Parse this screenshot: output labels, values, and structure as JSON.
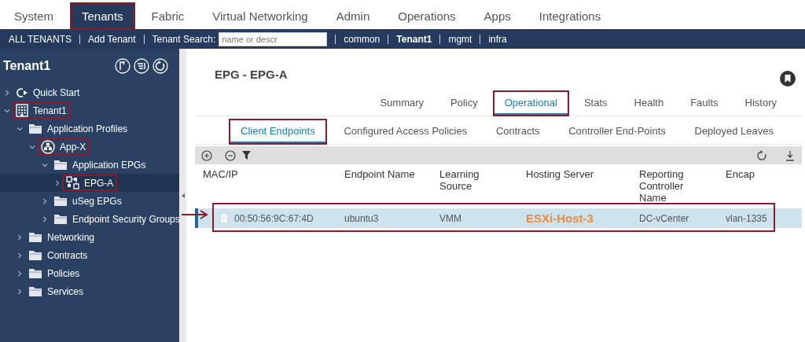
{
  "top_tabs": [
    {
      "label": "System",
      "selected": false,
      "highlighted": false
    },
    {
      "label": "Tenants",
      "selected": true,
      "highlighted": true
    },
    {
      "label": "Fabric",
      "selected": false,
      "highlighted": false
    },
    {
      "label": "Virtual Networking",
      "selected": false,
      "highlighted": false
    },
    {
      "label": "Admin",
      "selected": false,
      "highlighted": false
    },
    {
      "label": "Operations",
      "selected": false,
      "highlighted": false
    },
    {
      "label": "Apps",
      "selected": false,
      "highlighted": false
    },
    {
      "label": "Integrations",
      "selected": false,
      "highlighted": false
    }
  ],
  "tenant_bar": [
    {
      "kind": "link",
      "label": "ALL TENANTS",
      "selected": false
    },
    {
      "kind": "link",
      "label": "Add Tenant",
      "selected": false
    },
    {
      "kind": "search",
      "label": "Tenant Search:",
      "placeholder": "name or descr"
    },
    {
      "kind": "link",
      "label": "common",
      "selected": false
    },
    {
      "kind": "link",
      "label": "Tenant1",
      "selected": true
    },
    {
      "kind": "link",
      "label": "mgmt",
      "selected": false
    },
    {
      "kind": "link",
      "label": "infra",
      "selected": false
    }
  ],
  "sidebar": {
    "title": "Tenant1",
    "tree": [
      {
        "label": "Quick Start",
        "kind": "quickstart",
        "expanded": false,
        "selected": false,
        "highlighted": false
      },
      {
        "label": "Tenant1",
        "kind": "tenant",
        "expanded": true,
        "selected": false,
        "highlighted": true,
        "children": [
          {
            "label": "Application Profiles",
            "kind": "folder",
            "expanded": true,
            "selected": false,
            "highlighted": false,
            "children": [
              {
                "label": "App-X",
                "kind": "app",
                "expanded": true,
                "selected": false,
                "highlighted": true,
                "children": [
                  {
                    "label": "Application EPGs",
                    "kind": "folder",
                    "expanded": true,
                    "selected": false,
                    "highlighted": false,
                    "children": [
                      {
                        "label": "EPG-A",
                        "kind": "epg",
                        "expanded": false,
                        "selected": true,
                        "highlighted": true
                      }
                    ]
                  },
                  {
                    "label": "uSeg EPGs",
                    "kind": "folder",
                    "expanded": false,
                    "selected": false,
                    "highlighted": false
                  },
                  {
                    "label": "Endpoint Security Groups",
                    "kind": "folder",
                    "expanded": false,
                    "selected": false,
                    "highlighted": false
                  }
                ]
              }
            ]
          },
          {
            "label": "Networking",
            "kind": "folder",
            "expanded": false,
            "selected": false,
            "highlighted": false
          },
          {
            "label": "Contracts",
            "kind": "folder",
            "expanded": false,
            "selected": false,
            "highlighted": false
          },
          {
            "label": "Policies",
            "kind": "folder",
            "expanded": false,
            "selected": false,
            "highlighted": false
          },
          {
            "label": "Services",
            "kind": "folder",
            "expanded": false,
            "selected": false,
            "highlighted": false
          }
        ]
      }
    ]
  },
  "main": {
    "title": "EPG - EPG-A",
    "tabs": [
      {
        "label": "Summary",
        "selected": false,
        "highlighted": false
      },
      {
        "label": "Policy",
        "selected": false,
        "highlighted": false
      },
      {
        "label": "Operational",
        "selected": true,
        "highlighted": true
      },
      {
        "label": "Stats",
        "selected": false,
        "highlighted": false
      },
      {
        "label": "Health",
        "selected": false,
        "highlighted": false
      },
      {
        "label": "Faults",
        "selected": false,
        "highlighted": false
      },
      {
        "label": "History",
        "selected": false,
        "highlighted": false
      }
    ],
    "subtabs": [
      {
        "label": "Client Endpoints",
        "selected": true,
        "highlighted": true
      },
      {
        "label": "Configured Access Policies",
        "selected": false,
        "highlighted": false
      },
      {
        "label": "Contracts",
        "selected": false,
        "highlighted": false
      },
      {
        "label": "Controller End-Points",
        "selected": false,
        "highlighted": false
      },
      {
        "label": "Deployed Leaves",
        "selected": false,
        "highlighted": false
      }
    ],
    "table": {
      "columns": [
        "MAC/IP",
        "Endpoint Name",
        "Learning Source",
        "Hosting Server",
        "Reporting Controller Name",
        "Encap"
      ],
      "rows": [
        {
          "selected": true,
          "highlighted": true,
          "cells": [
            {
              "text": "00:50:56:9C:67:4D",
              "emphasized": false
            },
            {
              "text": "ubuntu3",
              "emphasized": false
            },
            {
              "text": "VMM",
              "emphasized": false
            },
            {
              "text": "ESXi-Host-3",
              "emphasized": true
            },
            {
              "text": "DC-vCenter",
              "emphasized": false
            },
            {
              "text": "vlan-1335",
              "emphasized": false
            }
          ]
        }
      ]
    }
  }
}
